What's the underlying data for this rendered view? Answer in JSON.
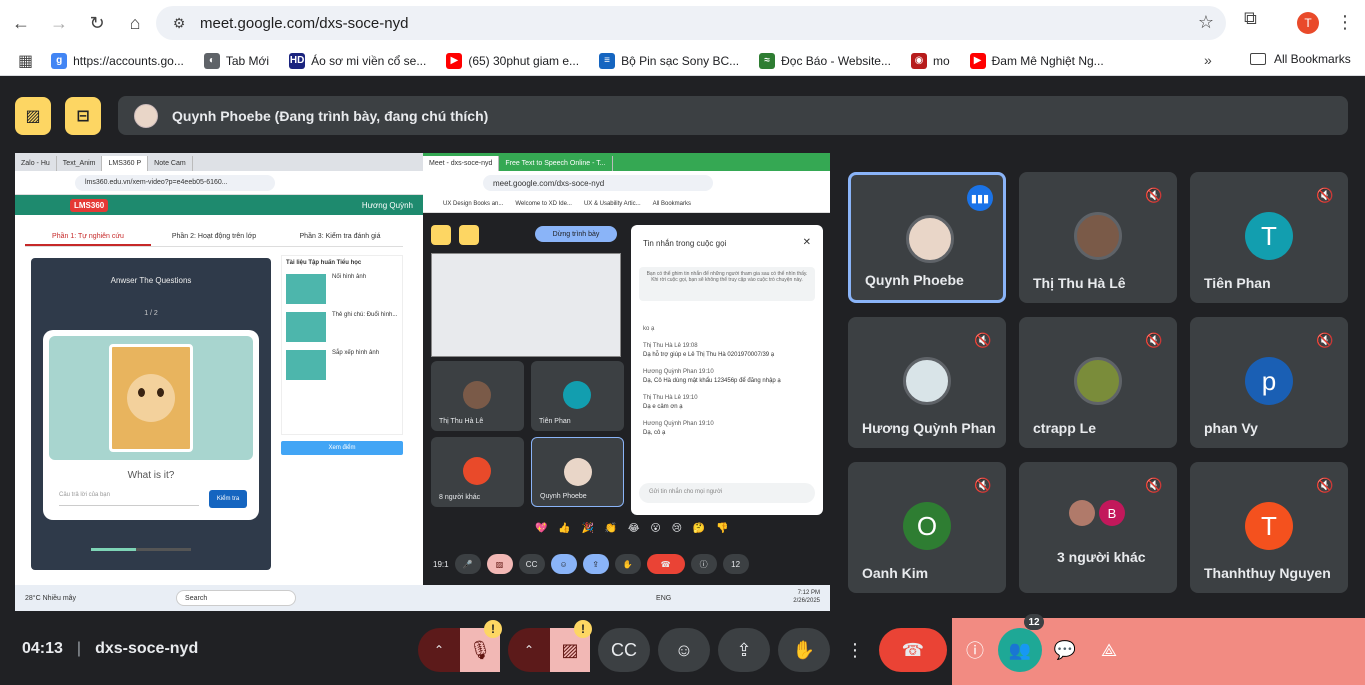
{
  "browser": {
    "url": "meet.google.com/dxs-soce-nyd",
    "profile_initial": "T",
    "bookmarks": [
      {
        "label": "https://accounts.go...",
        "color": "#4285f4",
        "glyph": "g"
      },
      {
        "label": "Tab Mới",
        "color": "#5f6368",
        "glyph": "◐"
      },
      {
        "label": "Áo sơ mi viền cổ se...",
        "color": "#1a237e",
        "glyph": "HD"
      },
      {
        "label": "(65) 30phut giam e...",
        "color": "#ff0000",
        "glyph": "▶"
      },
      {
        "label": "Bộ Pin sạc Sony BC...",
        "color": "#1565c0",
        "glyph": "≡"
      },
      {
        "label": "Đọc Báo - Website...",
        "color": "#2e7d32",
        "glyph": "≈"
      },
      {
        "label": "mo",
        "color": "#b71c1c",
        "glyph": "◉"
      },
      {
        "label": "Đam Mê Nghiệt Ng...",
        "color": "#ff0000",
        "glyph": "▶"
      }
    ],
    "all_bookmarks": "All Bookmarks"
  },
  "meet": {
    "presenter_text": "Quynh Phoebe (Đang trình bày, đang chú thích)",
    "time": "04:13",
    "meeting_code": "dxs-soce-nyd",
    "people_count": "12"
  },
  "shared": {
    "left_tabs": [
      "Zalo - Hu",
      "Text_Anim",
      "LMS360 P",
      "Note Cam"
    ],
    "left_url": "lms360.edu.vn/xem-video?p=e4eeb05-6160...",
    "lms_logo": "LMS360",
    "lms_user": "Hương Quỳnh",
    "lms_tabs": [
      "Phần 1: Tự nghiên cứu",
      "Phần 2: Hoạt động trên lớp",
      "Phần 3: Kiểm tra đánh giá"
    ],
    "quiz_title": "Anwser The Questions",
    "quiz_count": "1 / 2",
    "quiz_question": "What is it?",
    "quiz_placeholder": "Câu trả lời của bạn",
    "quiz_check": "Kiểm tra",
    "quiz_progress": 0.45,
    "side_heading": "Tài liệu Tập huấn Tiểu học",
    "side_items": [
      "Nối hình ảnh",
      "Thẻ ghi chú: Đuổi hình...",
      "Sắp xếp hình ảnh"
    ],
    "see_button": "Xem điểm",
    "right_tabs": [
      "Meet - dxs-soce-nyd",
      "Free Text to Speech Online - T..."
    ],
    "right_url": "meet.google.com/dxs-soce-nyd",
    "right_bookmarks": [
      "UX Design Books an...",
      "Welcome to XD Ide...",
      "UX & Usability Artic...",
      "All Bookmarks"
    ],
    "stop_present": "Dừng trình bày",
    "mini_tiles": [
      "Thị Thu Hà Lê",
      "Tiên Phan",
      "8 người khác",
      "Quynh Phoebe"
    ],
    "chat_title": "Tin nhắn trong cuộc gọi",
    "chat_note": "Bạn có thể ghim tin nhắn để những người tham gia sau có thể nhìn thấy. Khi rời cuộc gọi, bạn sẽ không thể truy cập vào cuộc trò chuyện này.",
    "chat_messages": [
      {
        "who": "ko ạ",
        "text": ""
      },
      {
        "who": "Thị Thu Hà Lê  19:08",
        "text": "Dạ hỗ trợ giúp e Lê Thị Thu Hà 0201970007/39 ạ"
      },
      {
        "who": "Hương Quỳnh Phan  19:10",
        "text": "Dạ, Cô Hà dùng mật khẩu 123456p để đăng nhập ạ"
      },
      {
        "who": "Thị Thu Hà Lê  19:10",
        "text": "Dạ e cảm ơn ạ"
      },
      {
        "who": "Hương Quỳnh Phan  19:10",
        "text": "Dạ, cô ạ"
      }
    ],
    "chat_input": "Gửi tin nhắn cho mọi người",
    "emoji_row": "💖 👍 🎉 👏 😂 😮 😢 🤔 👎",
    "rw_time": "19:1",
    "rw_people": "12",
    "taskbar_weather": "28°C Nhiều mây",
    "taskbar_search": "Search",
    "taskbar_lang": "ENG",
    "taskbar_time": "7:12 PM",
    "taskbar_date": "2/26/2025"
  },
  "tiles": [
    {
      "name": "Quynh Phoebe",
      "speaking": true,
      "type": "photo",
      "bg": "#e9d6c8"
    },
    {
      "name": "Thị Thu Hà Lê",
      "type": "photo",
      "bg": "#7a5a48"
    },
    {
      "name": "Tiên Phan",
      "type": "letter",
      "letter": "T",
      "bg": "#129eaf"
    },
    {
      "name": "Hương Quỳnh Phan",
      "type": "photo",
      "bg": "#d9e4e8"
    },
    {
      "name": "ctrapp Le",
      "type": "photo",
      "bg": "#7a8c3a"
    },
    {
      "name": "phan Vy",
      "type": "letter",
      "letter": "p",
      "bg": "#1a5fb4"
    },
    {
      "name": "Oanh Kim",
      "type": "letter",
      "letter": "O",
      "bg": "#2e7d32"
    },
    {
      "name": "3 người khác",
      "type": "group",
      "letter": "B",
      "bg": "#c2185b"
    },
    {
      "name": "Thanhthuy Nguyen",
      "type": "letter",
      "letter": "T",
      "bg": "#f4511e"
    }
  ],
  "colors": {
    "accent_yellow": "#fdd663",
    "leave_red": "#ea4335",
    "active_teal": "#1ea896",
    "speaking_blue": "#8ab4f8",
    "panel_pink": "#f28b82"
  }
}
